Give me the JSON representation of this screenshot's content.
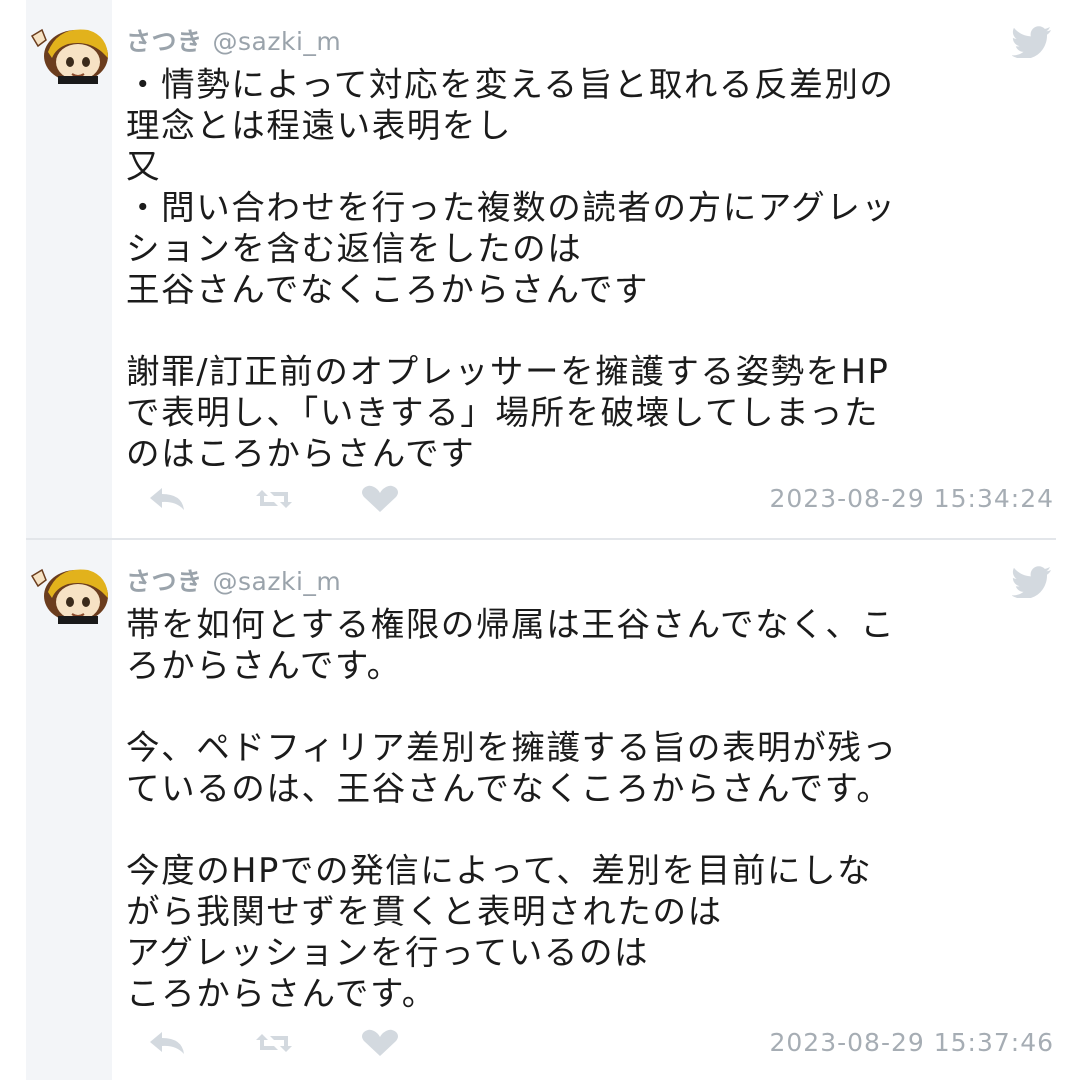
{
  "tweets": [
    {
      "display_name": "さつき",
      "handle": "@sazki_m",
      "lines": [
        "・情勢によって対応を変える旨と取れる反差別の",
        "理念とは程遠い表明をし",
        "又",
        "・問い合わせを行った複数の読者の方にアグレッ",
        "ションを含む返信をしたのは",
        "王谷さんでなくころからさんです",
        "",
        "謝罪/訂正前のオプレッサーを擁護する姿勢をHP",
        "で表明し、「いきする」場所を破壊してしまった",
        "のはころからさんです"
      ],
      "timestamp": "2023-08-29 15:34:24",
      "icons": {
        "reply": "reply-icon",
        "retweet": "retweet-icon",
        "like": "heart-icon",
        "bird": "twitter-bird-icon"
      }
    },
    {
      "display_name": "さつき",
      "handle": "@sazki_m",
      "lines": [
        "帯を如何とする権限の帰属は王谷さんでなく、こ",
        "ろからさんです。",
        "",
        "今、ペドフィリア差別を擁護する旨の表明が残っ",
        "ているのは、王谷さんでなくころからさんです。",
        "",
        "今度のHPでの発信によって、差別を目前にしな",
        "がら我関せずを貫くと表明されたのは",
        "アグレッションを行っているのは",
        "ころからさんです。"
      ],
      "timestamp": "2023-08-29 15:37:46",
      "icons": {
        "reply": "reply-icon",
        "retweet": "retweet-icon",
        "like": "heart-icon",
        "bird": "twitter-bird-icon"
      }
    }
  ],
  "colors": {
    "text": "#1b1b1b",
    "meta": "#9aa3ab",
    "icon": "#d3d9df",
    "rail": "#f3f5f8",
    "divider": "#e3e6ea"
  }
}
